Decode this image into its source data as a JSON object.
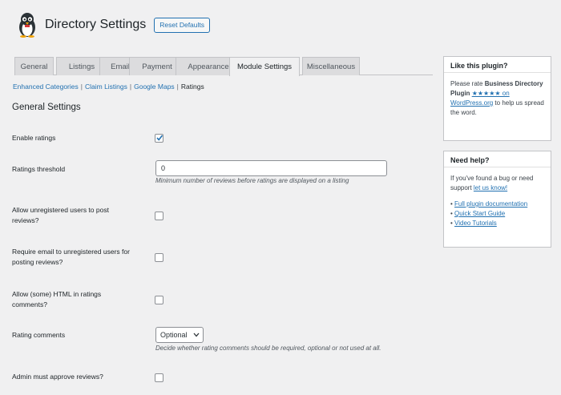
{
  "header": {
    "title": "Directory Settings",
    "reset_label": "Reset Defaults"
  },
  "tabs": [
    {
      "label": "General",
      "active": false
    },
    {
      "label": "Listings",
      "active": false
    },
    {
      "label": "Email",
      "active": false
    },
    {
      "label": "Payment",
      "active": false
    },
    {
      "label": "Appearance",
      "active": false
    },
    {
      "label": "Module Settings",
      "active": true
    },
    {
      "label": "Miscellaneous",
      "active": false
    }
  ],
  "subnav": {
    "links": [
      "Enhanced Categories",
      "Claim Listings",
      "Google Maps"
    ],
    "separator": "|",
    "current": "Ratings"
  },
  "section_title": "General Settings",
  "settings": {
    "enable_ratings": {
      "label": "Enable ratings",
      "checked": true
    },
    "threshold": {
      "label": "Ratings threshold",
      "value": "0",
      "description": "Minimum number of reviews before ratings are displayed on a listing"
    },
    "allow_unregistered": {
      "label": "Allow unregistered users to post reviews?",
      "checked": false
    },
    "require_email": {
      "label": "Require email to unregistered users for posting reviews?",
      "checked": false
    },
    "allow_html": {
      "label": "Allow (some) HTML in ratings comments?",
      "checked": false
    },
    "rating_comments": {
      "label": "Rating comments",
      "value": "Optional",
      "description": "Decide whether rating comments should be required, optional or not used at all."
    },
    "admin_approve": {
      "label": "Admin must approve reviews?",
      "checked": false
    }
  },
  "sidebar": {
    "like": {
      "title": "Like this plugin?",
      "text_before": "Please rate ",
      "plugin_name": "Business Directory Plugin",
      "link_text": "★★★★★ on WordPress.org",
      "text_after": " to help us spread the word."
    },
    "help": {
      "title": "Need help?",
      "text": "If you've found a bug or need support ",
      "link_text": "let us know!",
      "links": [
        "Full plugin documentation",
        "Quick Start Guide",
        "Video Tutorials"
      ]
    }
  },
  "colors": {
    "link": "#2271b1",
    "border": "#c3c4c7",
    "background": "#f0f0f1"
  }
}
